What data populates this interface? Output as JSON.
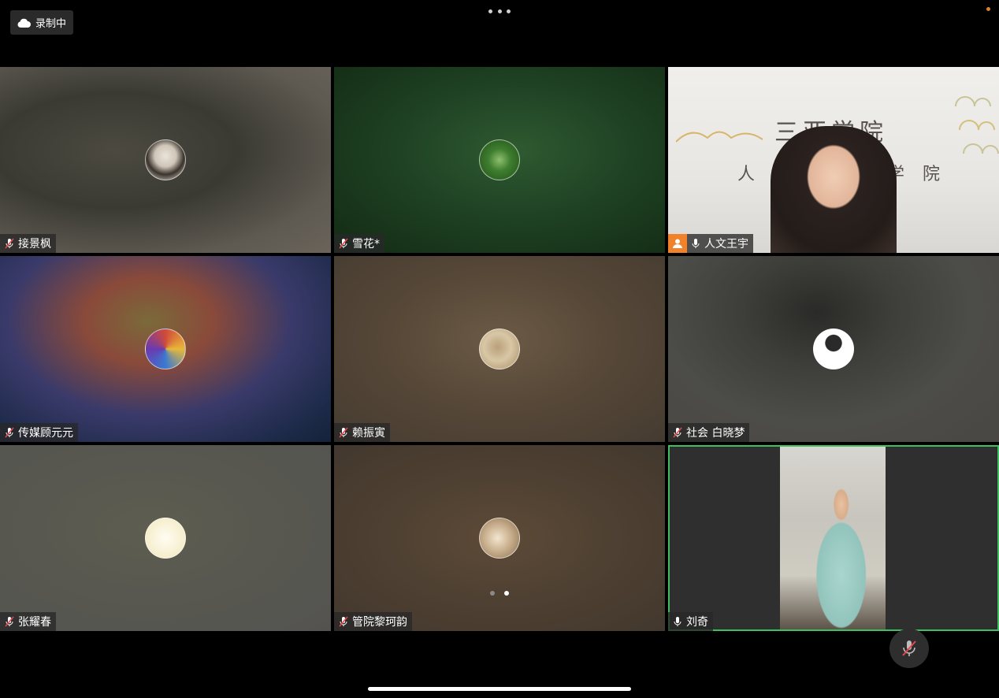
{
  "status": {
    "recording_label": "录制中"
  },
  "participants": [
    {
      "name": "接景枫",
      "muted": true
    },
    {
      "name": "雪花*",
      "muted": true
    },
    {
      "name": "人文王宇",
      "muted": false,
      "host": true,
      "banner_title": "三亚学院",
      "banner_sub_left": "人 文",
      "banner_sub_right": "学 院"
    },
    {
      "name": "传媒顾元元",
      "muted": true
    },
    {
      "name": "赖振寅",
      "muted": true
    },
    {
      "name": "社会 白晓梦",
      "muted": true
    },
    {
      "name": "张耀春",
      "muted": true
    },
    {
      "name": "管院黎珂韵",
      "muted": true
    },
    {
      "name": "刘奇",
      "muted": false,
      "active_speaker": true
    }
  ],
  "pagination": {
    "total": 2,
    "current": 2
  },
  "colors": {
    "active_border": "#3fbf5f",
    "host_badge": "#f0822a",
    "recording_dot": "#d9822b"
  },
  "icons": {
    "recording": "cloud-icon",
    "menu": "more-dots-icon",
    "mute": "mic-muted-icon"
  }
}
